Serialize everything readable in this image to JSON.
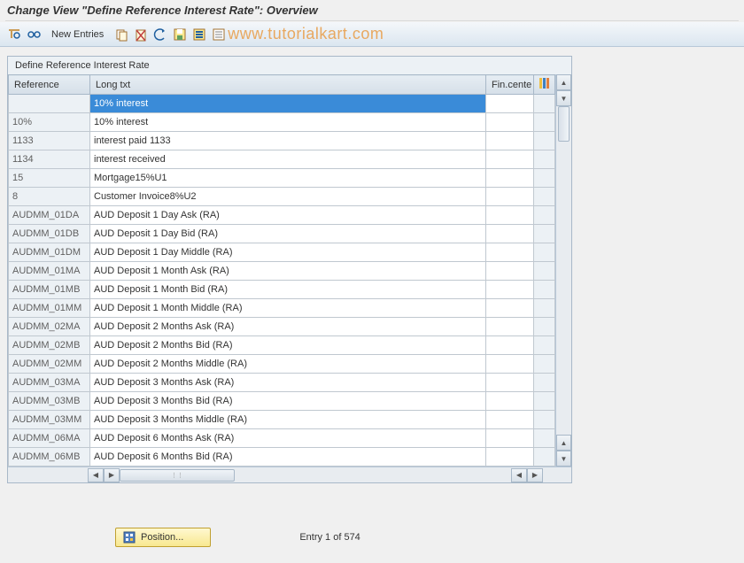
{
  "header": {
    "title": "Change View \"Define Reference Interest Rate\": Overview"
  },
  "toolbar": {
    "new_entries": "New Entries"
  },
  "watermark": "www.tutorialkart.com",
  "panel": {
    "title": "Define Reference Interest Rate",
    "columns": {
      "reference": "Reference",
      "long_txt": "Long txt",
      "fin_center": "Fin.cente"
    },
    "rows": [
      {
        "ref": "",
        "long": "10% interest",
        "selected": true
      },
      {
        "ref": "10%",
        "long": "10% interest"
      },
      {
        "ref": "1133",
        "long": "interest paid 1133"
      },
      {
        "ref": "1134",
        "long": "interest received"
      },
      {
        "ref": "15",
        "long": "Mortgage15%U1"
      },
      {
        "ref": "8",
        "long": "Customer Invoice8%U2"
      },
      {
        "ref": "AUDMM_01DA",
        "long": "AUD Deposit 1 Day Ask (RA)"
      },
      {
        "ref": "AUDMM_01DB",
        "long": "AUD Deposit 1 Day Bid (RA)"
      },
      {
        "ref": "AUDMM_01DM",
        "long": "AUD Deposit 1 Day Middle (RA)"
      },
      {
        "ref": "AUDMM_01MA",
        "long": "AUD Deposit 1 Month Ask (RA)"
      },
      {
        "ref": "AUDMM_01MB",
        "long": "AUD Deposit 1 Month Bid (RA)"
      },
      {
        "ref": "AUDMM_01MM",
        "long": "AUD Deposit 1 Month Middle (RA)"
      },
      {
        "ref": "AUDMM_02MA",
        "long": "AUD Deposit 2 Months Ask (RA)"
      },
      {
        "ref": "AUDMM_02MB",
        "long": "AUD Deposit 2 Months Bid (RA)"
      },
      {
        "ref": "AUDMM_02MM",
        "long": "AUD Deposit 2 Months Middle (RA)"
      },
      {
        "ref": "AUDMM_03MA",
        "long": "AUD Deposit 3 Months Ask (RA)"
      },
      {
        "ref": "AUDMM_03MB",
        "long": "AUD Deposit 3 Months Bid (RA)"
      },
      {
        "ref": "AUDMM_03MM",
        "long": "AUD Deposit 3 Months Middle (RA)"
      },
      {
        "ref": "AUDMM_06MA",
        "long": "AUD Deposit 6 Months Ask (RA)"
      },
      {
        "ref": "AUDMM_06MB",
        "long": "AUD Deposit 6 Months Bid (RA)"
      }
    ]
  },
  "footer": {
    "position_btn": "Position...",
    "entry_text": "Entry 1 of 574"
  }
}
